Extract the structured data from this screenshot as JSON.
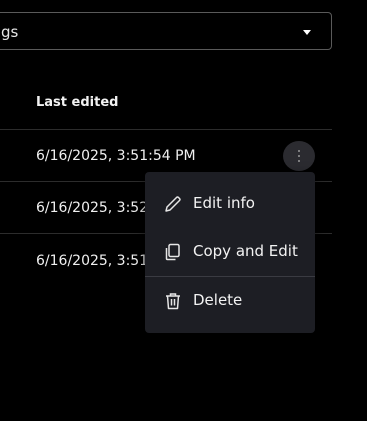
{
  "filter": {
    "value": "gs"
  },
  "table": {
    "header": {
      "last_edited": "Last edited"
    },
    "rows": [
      {
        "last_edited": "6/16/2025, 3:51:54 PM"
      },
      {
        "last_edited": "6/16/2025, 3:52"
      },
      {
        "last_edited": "6/16/2025, 3:51:"
      }
    ]
  },
  "context_menu": {
    "items": [
      {
        "label": "Edit info",
        "icon": "pencil-icon"
      },
      {
        "label": "Copy and Edit",
        "icon": "copy-icon"
      },
      {
        "label": "Delete",
        "icon": "trash-icon"
      }
    ]
  },
  "colors": {
    "background": "#000000",
    "menu_background": "#1d1e24",
    "kebab_background": "#2b2b30"
  }
}
